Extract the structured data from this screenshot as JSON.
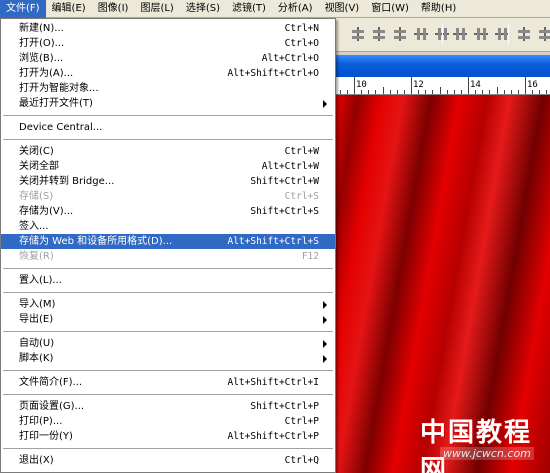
{
  "menubar": {
    "items": [
      {
        "label": "文件(F)",
        "active": true
      },
      {
        "label": "编辑(E)"
      },
      {
        "label": "图像(I)"
      },
      {
        "label": "图层(L)"
      },
      {
        "label": "选择(S)"
      },
      {
        "label": "滤镜(T)"
      },
      {
        "label": "分析(A)"
      },
      {
        "label": "视图(V)"
      },
      {
        "label": "窗口(W)"
      },
      {
        "label": "帮助(H)"
      }
    ]
  },
  "ruler": {
    "labels": [
      "10",
      "12",
      "14",
      "16"
    ]
  },
  "file_menu": {
    "groups": [
      [
        {
          "label": "新建(N)...",
          "shortcut": "Ctrl+N"
        },
        {
          "label": "打开(O)...",
          "shortcut": "Ctrl+O"
        },
        {
          "label": "浏览(B)...",
          "shortcut": "Alt+Ctrl+O"
        },
        {
          "label": "打开为(A)...",
          "shortcut": "Alt+Shift+Ctrl+O"
        },
        {
          "label": "打开为智能对象...",
          "shortcut": ""
        },
        {
          "label": "最近打开文件(T)",
          "shortcut": "",
          "submenu": true
        }
      ],
      [
        {
          "label": "Device Central...",
          "shortcut": ""
        }
      ],
      [
        {
          "label": "关闭(C)",
          "shortcut": "Ctrl+W"
        },
        {
          "label": "关闭全部",
          "shortcut": "Alt+Ctrl+W"
        },
        {
          "label": "关闭并转到 Bridge...",
          "shortcut": "Shift+Ctrl+W"
        },
        {
          "label": "存储(S)",
          "shortcut": "Ctrl+S",
          "disabled": true
        },
        {
          "label": "存储为(V)...",
          "shortcut": "Shift+Ctrl+S"
        },
        {
          "label": "签入...",
          "shortcut": ""
        },
        {
          "label": "存储为 Web 和设备所用格式(D)...",
          "shortcut": "Alt+Shift+Ctrl+S",
          "highlighted": true
        },
        {
          "label": "恢复(R)",
          "shortcut": "F12",
          "disabled": true
        }
      ],
      [
        {
          "label": "置入(L)...",
          "shortcut": ""
        }
      ],
      [
        {
          "label": "导入(M)",
          "shortcut": "",
          "submenu": true
        },
        {
          "label": "导出(E)",
          "shortcut": "",
          "submenu": true
        }
      ],
      [
        {
          "label": "自动(U)",
          "shortcut": "",
          "submenu": true
        },
        {
          "label": "脚本(K)",
          "shortcut": "",
          "submenu": true
        }
      ],
      [
        {
          "label": "文件简介(F)...",
          "shortcut": "Alt+Shift+Ctrl+I"
        }
      ],
      [
        {
          "label": "页面设置(G)...",
          "shortcut": "Shift+Ctrl+P"
        },
        {
          "label": "打印(P)...",
          "shortcut": "Ctrl+P"
        },
        {
          "label": "打印一份(Y)",
          "shortcut": "Alt+Shift+Ctrl+P"
        }
      ],
      [
        {
          "label": "退出(X)",
          "shortcut": "Ctrl+Q"
        }
      ]
    ]
  },
  "watermark": {
    "text": "中国教程网",
    "url": "www.jcwcn.com"
  },
  "colors": {
    "highlight": "#316ac5",
    "canvas": "#e30000",
    "menubar": "#ece9d8"
  }
}
